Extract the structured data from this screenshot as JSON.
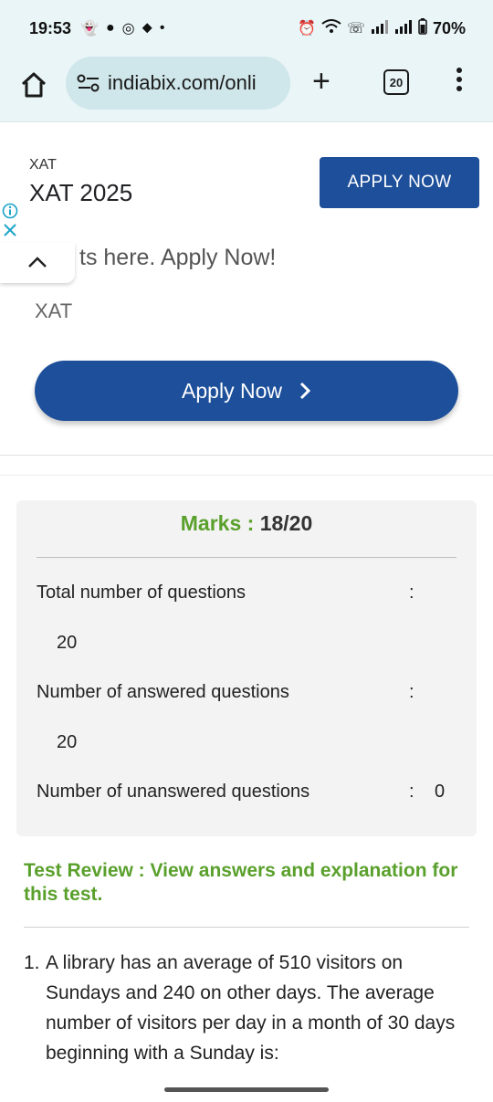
{
  "status_bar": {
    "time": "19:53",
    "battery": "70%",
    "left_icons": [
      "snapchat-icon",
      "chat-icon",
      "instagram-icon",
      "location-icon",
      "dot-icon"
    ],
    "right_icons": [
      "alarm-icon",
      "wifi-icon",
      "call-icon",
      "signal-icon",
      "signal-icon-2",
      "battery-icon"
    ]
  },
  "browser": {
    "url": "indiabix.com/onli",
    "tab_count": "20",
    "plus_label": "+"
  },
  "ad_top": {
    "advertiser": "XAT",
    "headline": "XAT 2025",
    "cta": "APPLY NOW"
  },
  "ad_second": {
    "tagline": "ts here. Apply Now!",
    "advertiser": "XAT",
    "cta": "Apply Now",
    "chevron": "›"
  },
  "results": {
    "marks_label": "Marks :",
    "marks_value": "18/20",
    "rows": [
      {
        "label": "Total number of questions",
        "colon": ":",
        "value": "20"
      },
      {
        "label": "Number of answered questions",
        "colon": ":",
        "value": "20"
      },
      {
        "label": "Number of unanswered questions",
        "colon": ":",
        "value": "0"
      }
    ]
  },
  "review": {
    "title": "Test Review : View answers and explanation for this test.",
    "question_number": "1.",
    "question_text": "A library has an average of 510 visitors on Sundays and 240 on other days. The average number of visitors per day in a month of 30 days beginning with a Sunday is:"
  },
  "colors": {
    "accent_green": "#5aa02c",
    "button_blue": "#1d4f9a",
    "browser_bar": "#eaf5f7"
  }
}
